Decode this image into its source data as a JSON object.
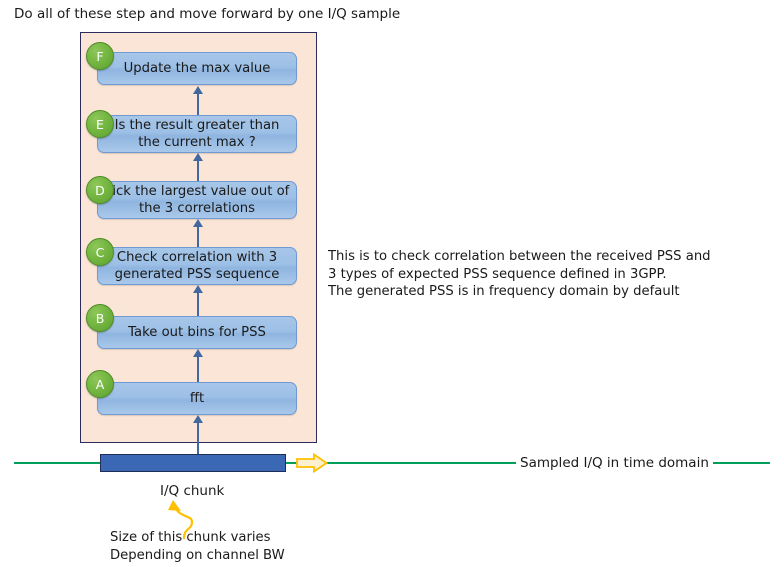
{
  "top_caption": "Do all of these step and move forward by one I/Q sample",
  "flow": {
    "steps": [
      {
        "badge": "F",
        "label": "Update the max value",
        "lines": 1
      },
      {
        "badge": "E",
        "label": "Is the result greater than the current max ?",
        "lines": 2
      },
      {
        "badge": "D",
        "label": "Pick the largest value out of the 3 correlations",
        "lines": 2
      },
      {
        "badge": "C",
        "label": "Check correlation with 3 generated PSS sequence",
        "lines": 2
      },
      {
        "badge": "B",
        "label": "Take out bins for PSS",
        "lines": 1
      },
      {
        "badge": "A",
        "label": "fft",
        "lines": 1
      }
    ]
  },
  "explanation": "This is to check correlation between the received PSS and\n3 types of expected PSS sequence defined in 3GPP.\nThe generated PSS is in frequency domain by default",
  "timeline": {
    "sampled_label": "Sampled I/Q in time domain",
    "chunk_label": "I/Q chunk",
    "chunk_note": "Size of this chunk varies\nDepending on channel BW"
  },
  "colors": {
    "container_fill": "#fbe5d6",
    "container_border": "#2b2b5e",
    "step_fill": "#9dc0e6",
    "step_border": "#6f9ad4",
    "badge_green": "#76b843",
    "arrow_blue": "#41699f",
    "timeline_green": "#00a05a",
    "chunk_blue": "#3a68b5",
    "chunk_border": "#1f2d57",
    "accent_yellow": "#ffc000"
  }
}
